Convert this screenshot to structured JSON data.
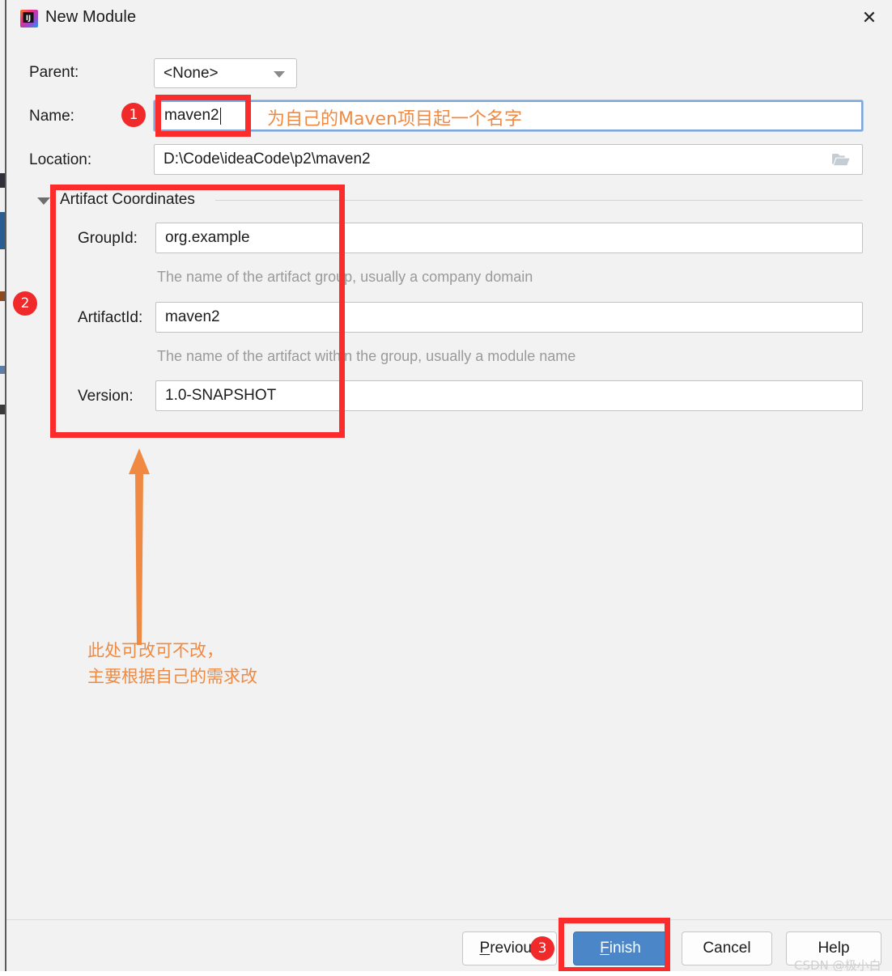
{
  "window": {
    "title": "New Module",
    "app_icon": "intellij-idea-icon",
    "close_icon": "close-icon"
  },
  "form": {
    "parent": {
      "label": "Parent:",
      "value": "<None>",
      "caret_icon": "chevron-down-icon"
    },
    "name": {
      "label": "Name:",
      "value": "maven2"
    },
    "location": {
      "label": "Location:",
      "value": "D:\\Code\\ideaCode\\p2\\maven2",
      "browse_icon": "folder-icon"
    }
  },
  "artifact_coordinates": {
    "group_title": "Artifact Coordinates",
    "twisty_icon": "triangle-down-icon",
    "group_id": {
      "label": "GroupId:",
      "value": "org.example",
      "hint": "The name of the artifact group, usually a company domain"
    },
    "artifact_id": {
      "label": "ArtifactId:",
      "value": "maven2",
      "hint": "The name of the artifact within the group, usually a module name"
    },
    "version": {
      "label": "Version:",
      "value": "1.0-SNAPSHOT"
    }
  },
  "footer": {
    "previous": {
      "label": "Previous",
      "mnemonic": "P"
    },
    "finish": {
      "label": "Finish",
      "mnemonic": "F"
    },
    "cancel": {
      "label": "Cancel"
    },
    "help": {
      "label": "Help"
    }
  },
  "annotations": {
    "badge_1": "1",
    "badge_2": "2",
    "badge_3": "3",
    "name_hint": "为自己的Maven项目起一个名字",
    "coords_note_line1": "此处可改可不改，",
    "coords_note_line2": "主要根据自己的需求改",
    "box_color": "#fb2c2c",
    "text_color": "#f08a42",
    "badge_color": "#f02a2a"
  },
  "watermark": {
    "text": "CSDN @极小白"
  }
}
